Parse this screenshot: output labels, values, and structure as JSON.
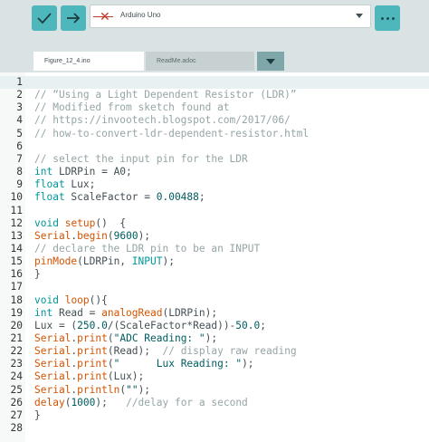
{
  "toolbar": {
    "verify_icon": "checkmark-icon",
    "upload_icon": "arrow-right-icon",
    "board_status_icon": "disconnected-x-icon",
    "board_name": "Arduino Uno",
    "menu_icon": "ellipsis-icon"
  },
  "tabs": [
    {
      "label": "Figure_12_4.ino",
      "active": true
    },
    {
      "label": "ReadMe.adoc",
      "active": false
    }
  ],
  "colors": {
    "accent": "#4db7bb",
    "keyword": "#d35400",
    "type": "#00979d",
    "comment": "#95a5a6",
    "literal": "#005c5f"
  },
  "editor": {
    "current_line": 1,
    "lines": [
      {
        "n": "1",
        "t": ""
      },
      {
        "n": "2",
        "t": "// “Using a Light Dependent Resistor (LDR)”"
      },
      {
        "n": "3",
        "t": "// Modified from sketch found at"
      },
      {
        "n": "4",
        "t": "// https://invootech.blogspot.com/2017/06/"
      },
      {
        "n": "5",
        "t": "// how-to-convert-ldr-dependent-resistor.html"
      },
      {
        "n": "6",
        "t": ""
      },
      {
        "n": "7",
        "t": "// select the input pin for the LDR"
      },
      {
        "n": "8",
        "t": "int LDRPin = A0;"
      },
      {
        "n": "9",
        "t": "float Lux;"
      },
      {
        "n": "10",
        "t": "float ScaleFactor = 0.00488;"
      },
      {
        "n": "11",
        "t": ""
      },
      {
        "n": "12",
        "t": "void setup()  {"
      },
      {
        "n": "13",
        "t": "Serial.begin(9600);"
      },
      {
        "n": "14",
        "t": "// declare the LDR pin to be an INPUT"
      },
      {
        "n": "15",
        "t": "pinMode(LDRPin, INPUT);"
      },
      {
        "n": "16",
        "t": "}"
      },
      {
        "n": "17",
        "t": ""
      },
      {
        "n": "18",
        "t": "void loop(){"
      },
      {
        "n": "19",
        "t": "int Read = analogRead(LDRPin);"
      },
      {
        "n": "20",
        "t": "Lux = (250.0/(ScaleFactor*Read))-50.0;"
      },
      {
        "n": "21",
        "t": "Serial.print(\"ADC Reading: \");"
      },
      {
        "n": "22",
        "t": "Serial.print(Read);  // display raw reading"
      },
      {
        "n": "23",
        "t": "Serial.print(\"      Lux Reading: \");"
      },
      {
        "n": "24",
        "t": "Serial.print(Lux);"
      },
      {
        "n": "25",
        "t": "Serial.println(\"\");"
      },
      {
        "n": "26",
        "t": "delay(1000);   //delay for a second"
      },
      {
        "n": "27",
        "t": "}"
      },
      {
        "n": "28",
        "t": ""
      }
    ]
  }
}
